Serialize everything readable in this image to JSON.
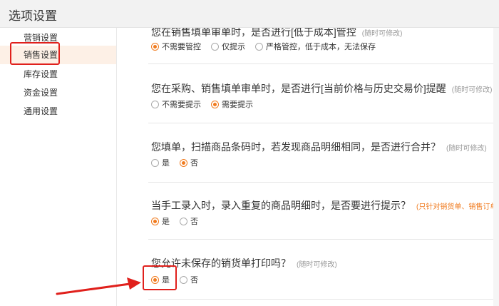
{
  "window": {
    "title": "选项设置"
  },
  "sidebar": {
    "items": [
      {
        "label": "营销设置"
      },
      {
        "label": "销售设置"
      },
      {
        "label": "库存设置"
      },
      {
        "label": "资金设置"
      },
      {
        "label": "通用设置"
      }
    ],
    "active_index": 1
  },
  "settings": [
    {
      "question": "您在销售填单审单时，是否进行[低于成本]管控",
      "hint": "(随时可修改)",
      "options": [
        "不需要管控",
        "仅提示",
        "严格管控，低于成本，无法保存"
      ],
      "selected": 0
    },
    {
      "question": "您在采购、销售填单审单时，是否进行[当前价格与历史交易价]提醒",
      "hint": "(随时可修改)",
      "options": [
        "不需要提示",
        "需要提示"
      ],
      "selected": 1
    },
    {
      "question": "您填单，扫描商品条码时，若发现商品明细相同，是否进行合并？",
      "hint": "(随时可修改)",
      "options": [
        "是",
        "否"
      ],
      "selected": 1
    },
    {
      "question": "当手工录入时，录入重复的商品明细时，是否要进行提示？",
      "hint": "(只针对销货单、销售订单",
      "options": [
        "是",
        "否"
      ],
      "selected": 0
    },
    {
      "question": "您允许未保存的销货单打印吗？",
      "hint": "(随时可修改)",
      "options": [
        "是",
        "否"
      ],
      "selected": 0
    }
  ],
  "colors": {
    "accent": "#f07b1f",
    "annotation": "#e0201c",
    "active_bg": "#fdf0e6"
  }
}
